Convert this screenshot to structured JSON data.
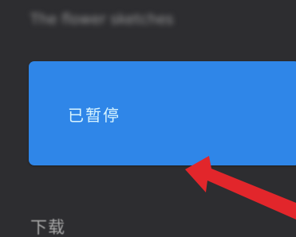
{
  "header": {
    "title": "The flower sketches"
  },
  "card": {
    "status": "已暂停",
    "color": "#2f86e8"
  },
  "section": {
    "download_label": "下载"
  },
  "annotation": {
    "arrow_icon": "red-arrow-icon",
    "color": "#e2262b"
  }
}
